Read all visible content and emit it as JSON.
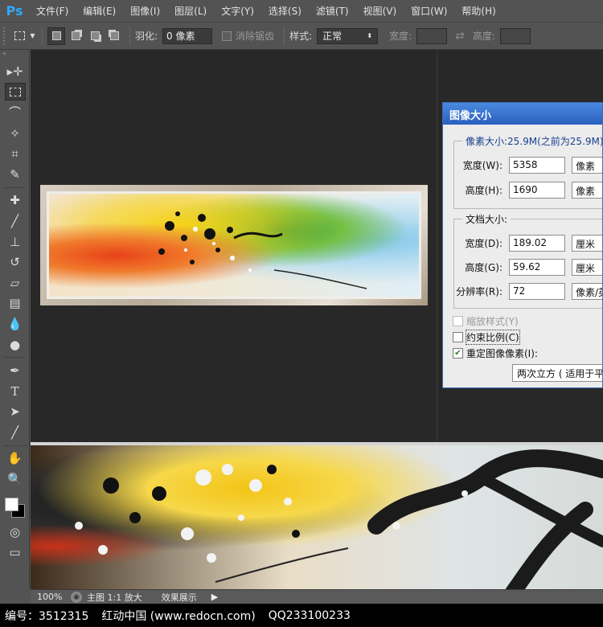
{
  "app": {
    "logo": "Ps"
  },
  "menu": [
    {
      "label": "文件(F)"
    },
    {
      "label": "编辑(E)"
    },
    {
      "label": "图像(I)"
    },
    {
      "label": "图层(L)"
    },
    {
      "label": "文字(Y)"
    },
    {
      "label": "选择(S)"
    },
    {
      "label": "滤镜(T)"
    },
    {
      "label": "视图(V)"
    },
    {
      "label": "窗口(W)"
    },
    {
      "label": "帮助(H)"
    }
  ],
  "options": {
    "feather_label": "羽化:",
    "feather_value": "0 像素",
    "antialias_label": "消除锯齿",
    "style_label": "样式:",
    "style_value": "正常",
    "width_label": "宽度:",
    "height_label": "高度:"
  },
  "status": {
    "zoom": "100%",
    "view_mode": "主图 1:1 放大",
    "effect": "效果展示"
  },
  "footer": {
    "id_text": "编号：3512315",
    "site": "红动中国 (www.redocn.com)",
    "qq": "QQ233100233"
  },
  "dialog": {
    "title": "图像大小",
    "pixel_dim_label": "像素大小:25.9M(之前为25.9M)",
    "pixel_width_label": "宽度(W):",
    "pixel_width_value": "5358",
    "pixel_width_unit": "像素",
    "pixel_height_label": "高度(H):",
    "pixel_height_value": "1690",
    "pixel_height_unit": "像素",
    "doc_size_label": "文档大小:",
    "doc_width_label": "宽度(D):",
    "doc_width_value": "189.02",
    "doc_width_unit": "厘米",
    "doc_height_label": "高度(G):",
    "doc_height_value": "59.62",
    "doc_height_unit": "厘米",
    "resolution_label": "分辨率(R):",
    "resolution_value": "72",
    "resolution_unit": "像素/英寸",
    "scale_styles_label": "缩放样式(Y)",
    "scale_styles_checked": false,
    "constrain_label": "约束比例(C)",
    "constrain_checked": false,
    "resample_label": "重定图像像素(I):",
    "resample_checked": true,
    "resample_method": "两次立方 ( 适用于平滑渐变)"
  },
  "tools": [
    "move-icon",
    "marquee-icon",
    "lasso-icon",
    "magic-wand-icon",
    "crop-icon",
    "eyedropper-icon",
    "healing-icon",
    "brush-icon",
    "stamp-icon",
    "history-brush-icon",
    "eraser-icon",
    "gradient-icon",
    "blur-icon",
    "dodge-icon",
    "pen-icon",
    "type-icon",
    "path-select-icon",
    "line-icon",
    "hand-icon",
    "zoom-icon"
  ]
}
